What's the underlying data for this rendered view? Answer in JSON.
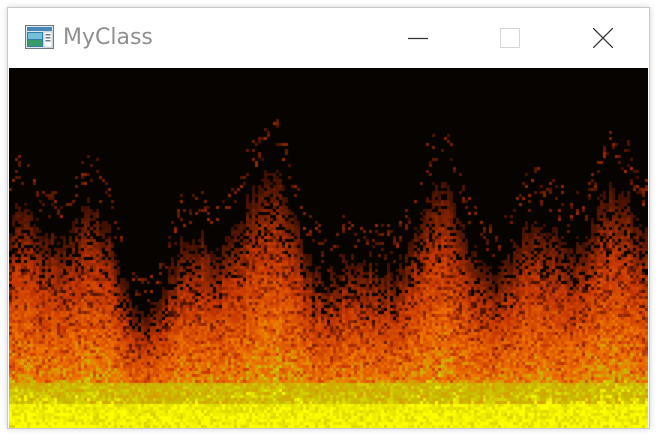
{
  "window": {
    "title": "MyClass",
    "controls": {
      "minimize": "minimize-icon",
      "maximize": "maximize-icon",
      "close": "close-icon"
    }
  },
  "canvas": {
    "content": "fire-animation",
    "palette": [
      "#060300",
      "#3a1000",
      "#8a2a00",
      "#d24a00",
      "#e87000",
      "#c9a000",
      "#e8e000",
      "#ffff00"
    ]
  },
  "colors": {
    "title_text": "#909090",
    "background": "#060300"
  }
}
